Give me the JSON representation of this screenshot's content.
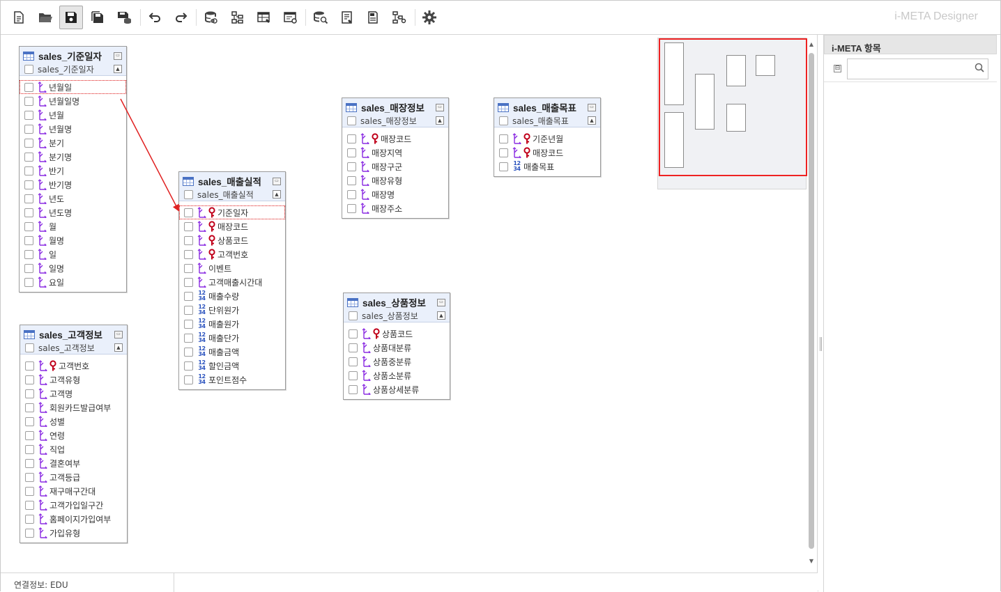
{
  "app": {
    "title": "i-META Designer"
  },
  "toolbar": {
    "buttons": [
      {
        "icon": "new-document-icon",
        "tooltip": ""
      },
      {
        "icon": "open-folder-icon",
        "tooltip": ""
      },
      {
        "icon": "save-icon",
        "tooltip": "",
        "active": true
      },
      {
        "icon": "save-as-icon",
        "tooltip": ""
      },
      {
        "icon": "save-db-icon",
        "tooltip": ""
      },
      {
        "icon": "undo-icon",
        "tooltip": ""
      },
      {
        "icon": "redo-icon",
        "tooltip": ""
      },
      {
        "icon": "database-link-icon",
        "tooltip": ""
      },
      {
        "icon": "hierarchy-icon",
        "tooltip": ""
      },
      {
        "icon": "table-edit-icon",
        "tooltip": ""
      },
      {
        "icon": "table-settings-icon",
        "tooltip": ""
      },
      {
        "icon": "database-search-icon",
        "tooltip": ""
      },
      {
        "icon": "list-edit-icon",
        "tooltip": ""
      },
      {
        "icon": "document-icon",
        "tooltip": ""
      },
      {
        "icon": "tree-settings-icon",
        "tooltip": ""
      },
      {
        "icon": "gear-icon",
        "tooltip": ""
      }
    ]
  },
  "entities": [
    {
      "id": "date",
      "name": "sales_기준일자",
      "sub": "sales_기준일자",
      "attrs": [
        {
          "label": "년월일",
          "fk": true,
          "pk": false,
          "num": false,
          "selected": true
        },
        {
          "label": "년월일명",
          "fk": true,
          "pk": false,
          "num": false
        },
        {
          "label": "년월",
          "fk": true,
          "pk": false,
          "num": false
        },
        {
          "label": "년월명",
          "fk": true,
          "pk": false,
          "num": false
        },
        {
          "label": "분기",
          "fk": true,
          "pk": false,
          "num": false
        },
        {
          "label": "분기명",
          "fk": true,
          "pk": false,
          "num": false
        },
        {
          "label": "반기",
          "fk": true,
          "pk": false,
          "num": false
        },
        {
          "label": "반기명",
          "fk": true,
          "pk": false,
          "num": false
        },
        {
          "label": "년도",
          "fk": true,
          "pk": false,
          "num": false
        },
        {
          "label": "년도명",
          "fk": true,
          "pk": false,
          "num": false
        },
        {
          "label": "월",
          "fk": true,
          "pk": false,
          "num": false
        },
        {
          "label": "월명",
          "fk": true,
          "pk": false,
          "num": false
        },
        {
          "label": "일",
          "fk": true,
          "pk": false,
          "num": false
        },
        {
          "label": "일명",
          "fk": true,
          "pk": false,
          "num": false
        },
        {
          "label": "요일",
          "fk": true,
          "pk": false,
          "num": false
        }
      ]
    },
    {
      "id": "customer",
      "name": "sales_고객정보",
      "sub": "sales_고객정보",
      "attrs": [
        {
          "label": "고객번호",
          "fk": true,
          "pk": true,
          "num": false
        },
        {
          "label": "고객유형",
          "fk": true,
          "pk": false,
          "num": false
        },
        {
          "label": "고객명",
          "fk": true,
          "pk": false,
          "num": false
        },
        {
          "label": "회원카드발급여부",
          "fk": true,
          "pk": false,
          "num": false
        },
        {
          "label": "성별",
          "fk": true,
          "pk": false,
          "num": false
        },
        {
          "label": "연령",
          "fk": true,
          "pk": false,
          "num": false
        },
        {
          "label": "직업",
          "fk": true,
          "pk": false,
          "num": false
        },
        {
          "label": "결혼여부",
          "fk": true,
          "pk": false,
          "num": false
        },
        {
          "label": "고객등급",
          "fk": true,
          "pk": false,
          "num": false
        },
        {
          "label": "재구매구간대",
          "fk": true,
          "pk": false,
          "num": false
        },
        {
          "label": "고객가입일구간",
          "fk": true,
          "pk": false,
          "num": false
        },
        {
          "label": "홈페이지가입여부",
          "fk": true,
          "pk": false,
          "num": false
        },
        {
          "label": "가입유형",
          "fk": true,
          "pk": false,
          "num": false
        }
      ]
    },
    {
      "id": "sales",
      "name": "sales_매출실적",
      "sub": "sales_매출실적",
      "attrs": [
        {
          "label": "기준일자",
          "fk": true,
          "pk": true,
          "num": false,
          "selected": true
        },
        {
          "label": "매장코드",
          "fk": true,
          "pk": true,
          "num": false
        },
        {
          "label": "상품코드",
          "fk": true,
          "pk": true,
          "num": false
        },
        {
          "label": "고객번호",
          "fk": true,
          "pk": true,
          "num": false
        },
        {
          "label": "이벤트",
          "fk": true,
          "pk": false,
          "num": false
        },
        {
          "label": "고객매출시간대",
          "fk": true,
          "pk": false,
          "num": false
        },
        {
          "label": "매출수량",
          "fk": false,
          "pk": false,
          "num": true
        },
        {
          "label": "단위원가",
          "fk": false,
          "pk": false,
          "num": true
        },
        {
          "label": "매출원가",
          "fk": false,
          "pk": false,
          "num": true
        },
        {
          "label": "매출단가",
          "fk": false,
          "pk": false,
          "num": true
        },
        {
          "label": "매출금액",
          "fk": false,
          "pk": false,
          "num": true
        },
        {
          "label": "할인금액",
          "fk": false,
          "pk": false,
          "num": true
        },
        {
          "label": "포인트점수",
          "fk": false,
          "pk": false,
          "num": true
        }
      ]
    },
    {
      "id": "store",
      "name": "sales_매장정보",
      "sub": "sales_매장정보",
      "attrs": [
        {
          "label": "매장코드",
          "fk": true,
          "pk": true,
          "num": false
        },
        {
          "label": "매장지역",
          "fk": true,
          "pk": false,
          "num": false
        },
        {
          "label": "매장구군",
          "fk": true,
          "pk": false,
          "num": false
        },
        {
          "label": "매장유형",
          "fk": true,
          "pk": false,
          "num": false
        },
        {
          "label": "매장명",
          "fk": true,
          "pk": false,
          "num": false
        },
        {
          "label": "매장주소",
          "fk": true,
          "pk": false,
          "num": false
        }
      ]
    },
    {
      "id": "product",
      "name": "sales_상품정보",
      "sub": "sales_상품정보",
      "attrs": [
        {
          "label": "상품코드",
          "fk": true,
          "pk": true,
          "num": false
        },
        {
          "label": "상품대분류",
          "fk": true,
          "pk": false,
          "num": false
        },
        {
          "label": "상품중분류",
          "fk": true,
          "pk": false,
          "num": false
        },
        {
          "label": "상품소분류",
          "fk": true,
          "pk": false,
          "num": false
        },
        {
          "label": "상품상세분류",
          "fk": true,
          "pk": false,
          "num": false
        }
      ]
    },
    {
      "id": "target",
      "name": "sales_매출목표",
      "sub": "sales_매출목표",
      "attrs": [
        {
          "label": "기준년월",
          "fk": true,
          "pk": true,
          "num": false
        },
        {
          "label": "매장코드",
          "fk": true,
          "pk": true,
          "num": false
        },
        {
          "label": "매출목표",
          "fk": false,
          "pk": false,
          "num": true
        }
      ]
    }
  ],
  "num_icon": {
    "top": "12",
    "bottom": "34"
  },
  "colors": {
    "relation_line": "#e02020",
    "fk_icon": "#8a2be2",
    "pk_icon": "#c0001a",
    "num_icon": "#2a52be",
    "header_bg": "#eaf0fb"
  },
  "side_panel": {
    "title": "i-META 항목",
    "tree_toggle": "⊟",
    "search_value": ""
  },
  "status": {
    "connection": "연결정보: EDU"
  }
}
